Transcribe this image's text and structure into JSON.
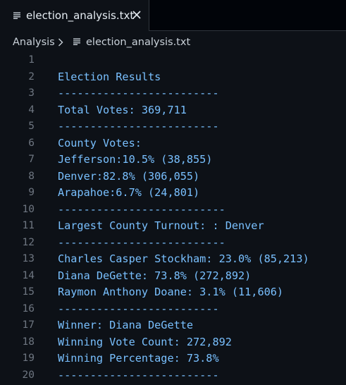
{
  "tab": {
    "title": "election_analysis.txt",
    "icon": "text-file-icon",
    "close_icon": "close-icon"
  },
  "breadcrumb": {
    "root": "Analysis",
    "file": "election_analysis.txt"
  },
  "colors": {
    "editor_bg": "#0d1117",
    "tabbar_bg": "#010409",
    "code_text": "#79c0ff",
    "line_number": "#6e7681",
    "ui_text": "#e6edf3"
  },
  "editor": {
    "lines": [
      {
        "n": "1",
        "text": ""
      },
      {
        "n": "2",
        "text": "Election Results"
      },
      {
        "n": "3",
        "text": "-------------------------"
      },
      {
        "n": "4",
        "text": "Total Votes: 369,711"
      },
      {
        "n": "5",
        "text": "-------------------------"
      },
      {
        "n": "6",
        "text": "County Votes:"
      },
      {
        "n": "7",
        "text": "Jefferson:10.5% (38,855)"
      },
      {
        "n": "8",
        "text": "Denver:82.8% (306,055)"
      },
      {
        "n": "9",
        "text": "Arapahoe:6.7% (24,801)"
      },
      {
        "n": "10",
        "text": "--------------------------"
      },
      {
        "n": "11",
        "text": "Largest County Turnout: : Denver"
      },
      {
        "n": "12",
        "text": "--------------------------"
      },
      {
        "n": "13",
        "text": "Charles Casper Stockham: 23.0% (85,213)"
      },
      {
        "n": "14",
        "text": "Diana DeGette: 73.8% (272,892)"
      },
      {
        "n": "15",
        "text": "Raymon Anthony Doane: 3.1% (11,606)"
      },
      {
        "n": "16",
        "text": "-------------------------"
      },
      {
        "n": "17",
        "text": "Winner: Diana DeGette"
      },
      {
        "n": "18",
        "text": "Winning Vote Count: 272,892"
      },
      {
        "n": "19",
        "text": "Winning Percentage: 73.8%"
      },
      {
        "n": "20",
        "text": "-------------------------"
      }
    ]
  }
}
